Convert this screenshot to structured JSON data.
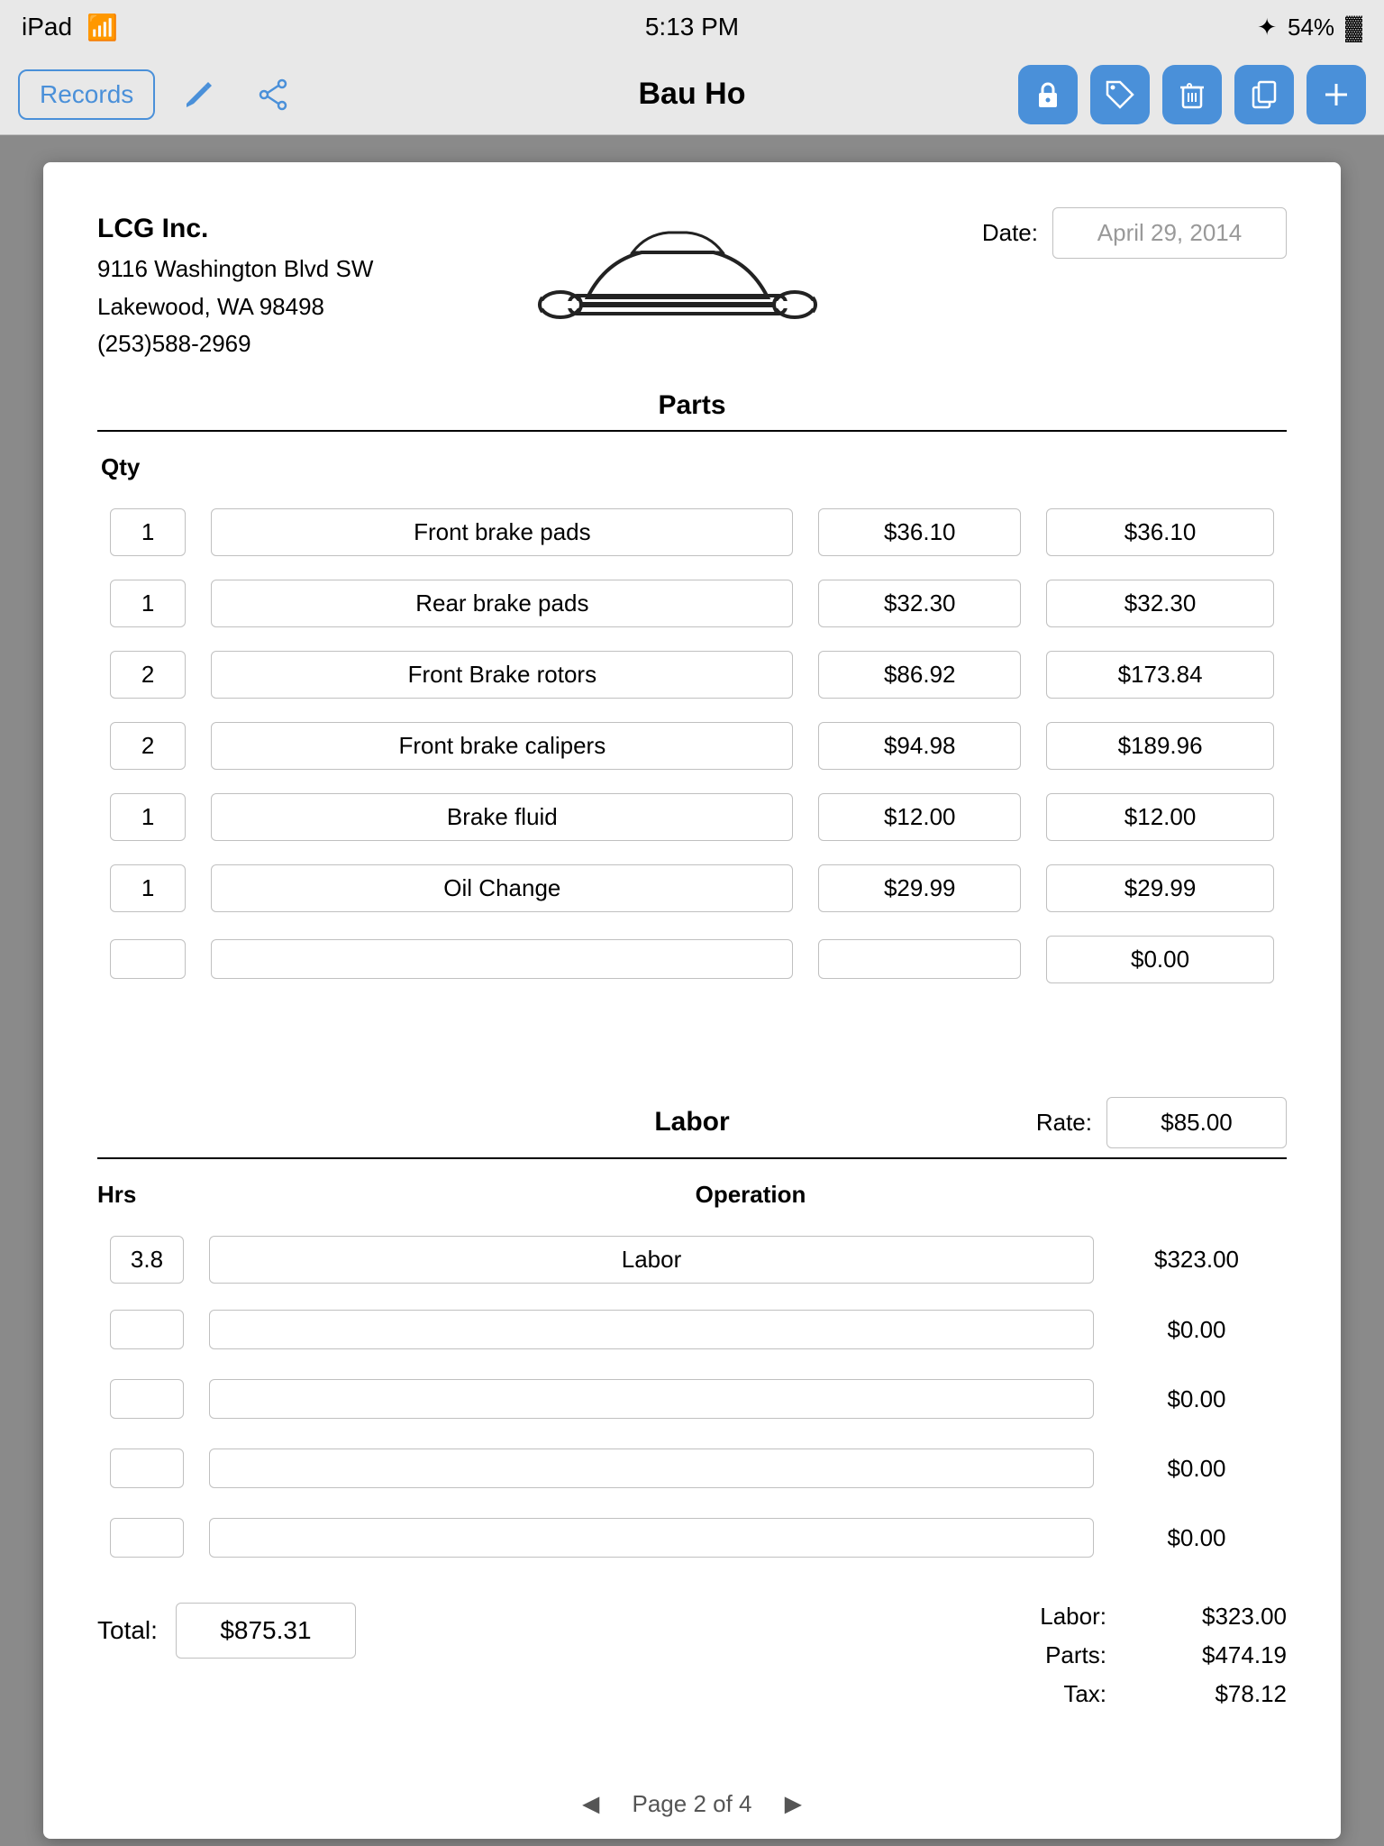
{
  "statusBar": {
    "device": "iPad",
    "wifi": true,
    "time": "5:13 PM",
    "bluetooth": true,
    "battery": "54%"
  },
  "navBar": {
    "title": "Bau Ho",
    "recordsLabel": "Records"
  },
  "document": {
    "company": {
      "name": "LCG Inc.",
      "address1": "9116 Washington Blvd SW",
      "address2": "Lakewood, WA  98498",
      "phone": "(253)588-2969"
    },
    "dateLabel": "Date:",
    "dateValue": "April 29, 2014",
    "partsSectionTitle": "Parts",
    "qtyHeader": "Qty",
    "parts": [
      {
        "qty": "1",
        "desc": "Front brake pads",
        "unitPrice": "$36.10",
        "total": "$36.10"
      },
      {
        "qty": "1",
        "desc": "Rear brake pads",
        "unitPrice": "$32.30",
        "total": "$32.30"
      },
      {
        "qty": "2",
        "desc": "Front Brake rotors",
        "unitPrice": "$86.92",
        "total": "$173.84"
      },
      {
        "qty": "2",
        "desc": "Front brake calipers",
        "unitPrice": "$94.98",
        "total": "$189.96"
      },
      {
        "qty": "1",
        "desc": "Brake fluid",
        "unitPrice": "$12.00",
        "total": "$12.00"
      },
      {
        "qty": "1",
        "desc": "Oil Change",
        "unitPrice": "$29.99",
        "total": "$29.99"
      },
      {
        "qty": "",
        "desc": "",
        "unitPrice": "",
        "total": "$0.00"
      }
    ],
    "laborSectionTitle": "Labor",
    "rateLabel": "Rate:",
    "rateValue": "$85.00",
    "hrsHeader": "Hrs",
    "operationHeader": "Operation",
    "laborRows": [
      {
        "hrs": "3.8",
        "operation": "Labor",
        "total": "$323.00"
      },
      {
        "hrs": "",
        "operation": "",
        "total": "$0.00"
      },
      {
        "hrs": "",
        "operation": "",
        "total": "$0.00"
      },
      {
        "hrs": "",
        "operation": "",
        "total": "$0.00"
      },
      {
        "hrs": "",
        "operation": "",
        "total": "$0.00"
      }
    ],
    "summary": {
      "totalLabel": "Total:",
      "totalValue": "$875.31",
      "laborLabel": "Labor:",
      "laborValue": "$323.00",
      "partsLabel": "Parts:",
      "partsValue": "$474.19",
      "taxLabel": "Tax:",
      "taxValue": "$78.12"
    },
    "pageText": "Page 2 of 4"
  }
}
